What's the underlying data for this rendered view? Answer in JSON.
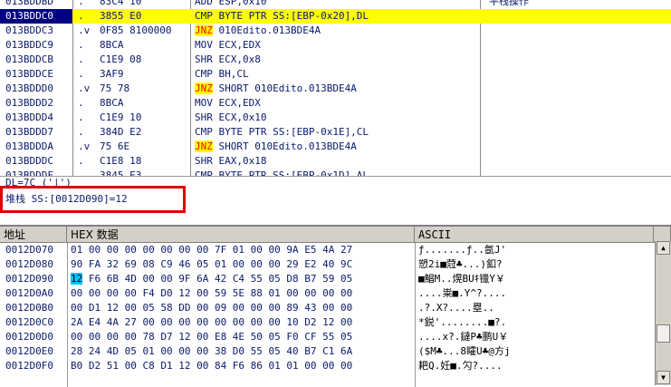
{
  "disasm": {
    "rows": [
      {
        "addr": "013BDDBD",
        "mark": ".",
        "hex": "83C4 10",
        "asm": "ADD ESP,0x10",
        "comment": "",
        "jnz": false,
        "sel": false
      },
      {
        "addr": "013BDDC0",
        "mark": ".",
        "hex": "3855 E0",
        "asm": "CMP BYTE PTR SS:[EBP-0x20],DL",
        "comment": "",
        "jnz": false,
        "sel": true
      },
      {
        "addr": "013BDDC3",
        "mark": ".v",
        "hex": "0F85 8100000",
        "asm_pre": "JNZ",
        "asm": " 010Edito.013BDE4A",
        "comment": "",
        "jnz": true,
        "sel": false
      },
      {
        "addr": "013BDDC9",
        "mark": ".",
        "hex": "8BCA",
        "asm": "MOV ECX,EDX",
        "comment": "",
        "jnz": false,
        "sel": false
      },
      {
        "addr": "013BDDCB",
        "mark": ".",
        "hex": "C1E9 08",
        "asm": "SHR ECX,0x8",
        "comment": "",
        "jnz": false,
        "sel": false
      },
      {
        "addr": "013BDDCE",
        "mark": ".",
        "hex": "3AF9",
        "asm": "CMP BH,CL",
        "comment": "",
        "jnz": false,
        "sel": false
      },
      {
        "addr": "013BDDD0",
        "mark": ".v",
        "hex": "75 78",
        "asm_pre": "JNZ",
        "asm": " SHORT 010Edito.013BDE4A",
        "comment": "",
        "jnz": true,
        "sel": false
      },
      {
        "addr": "013BDDD2",
        "mark": ".",
        "hex": "8BCA",
        "asm": "MOV ECX,EDX",
        "comment": "",
        "jnz": false,
        "sel": false
      },
      {
        "addr": "013BDDD4",
        "mark": ".",
        "hex": "C1E9 10",
        "asm": "SHR ECX,0x10",
        "comment": "",
        "jnz": false,
        "sel": false
      },
      {
        "addr": "013BDDD7",
        "mark": ".",
        "hex": "384D E2",
        "asm": "CMP BYTE PTR SS:[EBP-0x1E],CL",
        "comment": "",
        "jnz": false,
        "sel": false
      },
      {
        "addr": "013BDDDA",
        "mark": ".v",
        "hex": "75 6E",
        "asm_pre": "JNZ",
        "asm": " SHORT 010Edito.013BDE4A",
        "comment": "",
        "jnz": true,
        "sel": false
      },
      {
        "addr": "013BDDDC",
        "mark": ".",
        "hex": "C1E8 18",
        "asm": "SHR EAX,0x18",
        "comment": "",
        "jnz": false,
        "sel": false
      },
      {
        "addr": "013BDDDF",
        "mark": ".",
        "hex": "3845 E3",
        "asm": "CMP BYTE PTR SS:[EBP-0x1D],AL",
        "comment": "",
        "jnz": false,
        "sel": false
      }
    ],
    "top_comment": "平栈操作"
  },
  "info": {
    "line1": "DL=7C ('|')",
    "line2": "堆栈 SS:[0012D090]=12"
  },
  "dump": {
    "headers": {
      "addr": "地址",
      "hex": "HEX 数据",
      "ascii": "ASCII"
    },
    "rows": [
      {
        "addr": "0012D070",
        "bytes": "01 00 00 00 00 00 00 00 7F 01 00 00 9A E5 4A 27",
        "ascii": "ƒ.......ƒ..氬J'"
      },
      {
        "addr": "0012D080",
        "bytes": "90 FA 32 69 08 C9 46 05 01 00 00 00 29 E2 40 9C",
        "ascii": "愬2i■蒄♣...)釦?"
      },
      {
        "addr": "0012D090",
        "bytes_pre": "",
        "hl": "12",
        "bytes": " F6 6B 4D 00 00 9F 6A 42 C4 55 05 D8 B7 59 05",
        "ascii": "■鯧M..熀BUｷ镴Y￥"
      },
      {
        "addr": "0012D0A0",
        "bytes": "00 00 00 00 F4 D0 12 00 59 5E 88 01 00 00 00 00",
        "ascii": "....粜■.Y^?...."
      },
      {
        "addr": "0012D0B0",
        "bytes": "00 D1 12 00 05 58 DD 00 09 00 00 00 89 43 00 00",
        "ascii": ".?.X?....塁.."
      },
      {
        "addr": "0012D0C0",
        "bytes": "2A E4 4A 27 00 00 00 00 00 00 00 00 10 D2 12 00",
        "ascii": "*鋭'........■?."
      },
      {
        "addr": "0012D0D0",
        "bytes": "00 00 00 00 78 D7 12 00 E8 4E 50 05 F0 CF 55 05",
        "ascii": "....x?.鐽P♣鹏U￥"
      },
      {
        "addr": "0012D0E0",
        "bytes": "28 24 4D 05 01 00 00 00 38 D0 55 05 40 B7 C1 6A",
        "ascii": "($M♣...8矐U♣@方j"
      },
      {
        "addr": "0012D0F0",
        "bytes": "B0 D2 51 00 C8 D1 12 00 84 F6 86 01 01 00 00 00",
        "ascii": "耙Q.妊■.勽?...."
      }
    ]
  },
  "colors": {
    "selection": "#000080",
    "highlight_yellow": "#ffff00",
    "jnz_red": "#ff0000",
    "redbox": "#e00000",
    "byte_highlight": "#00c0ff"
  }
}
